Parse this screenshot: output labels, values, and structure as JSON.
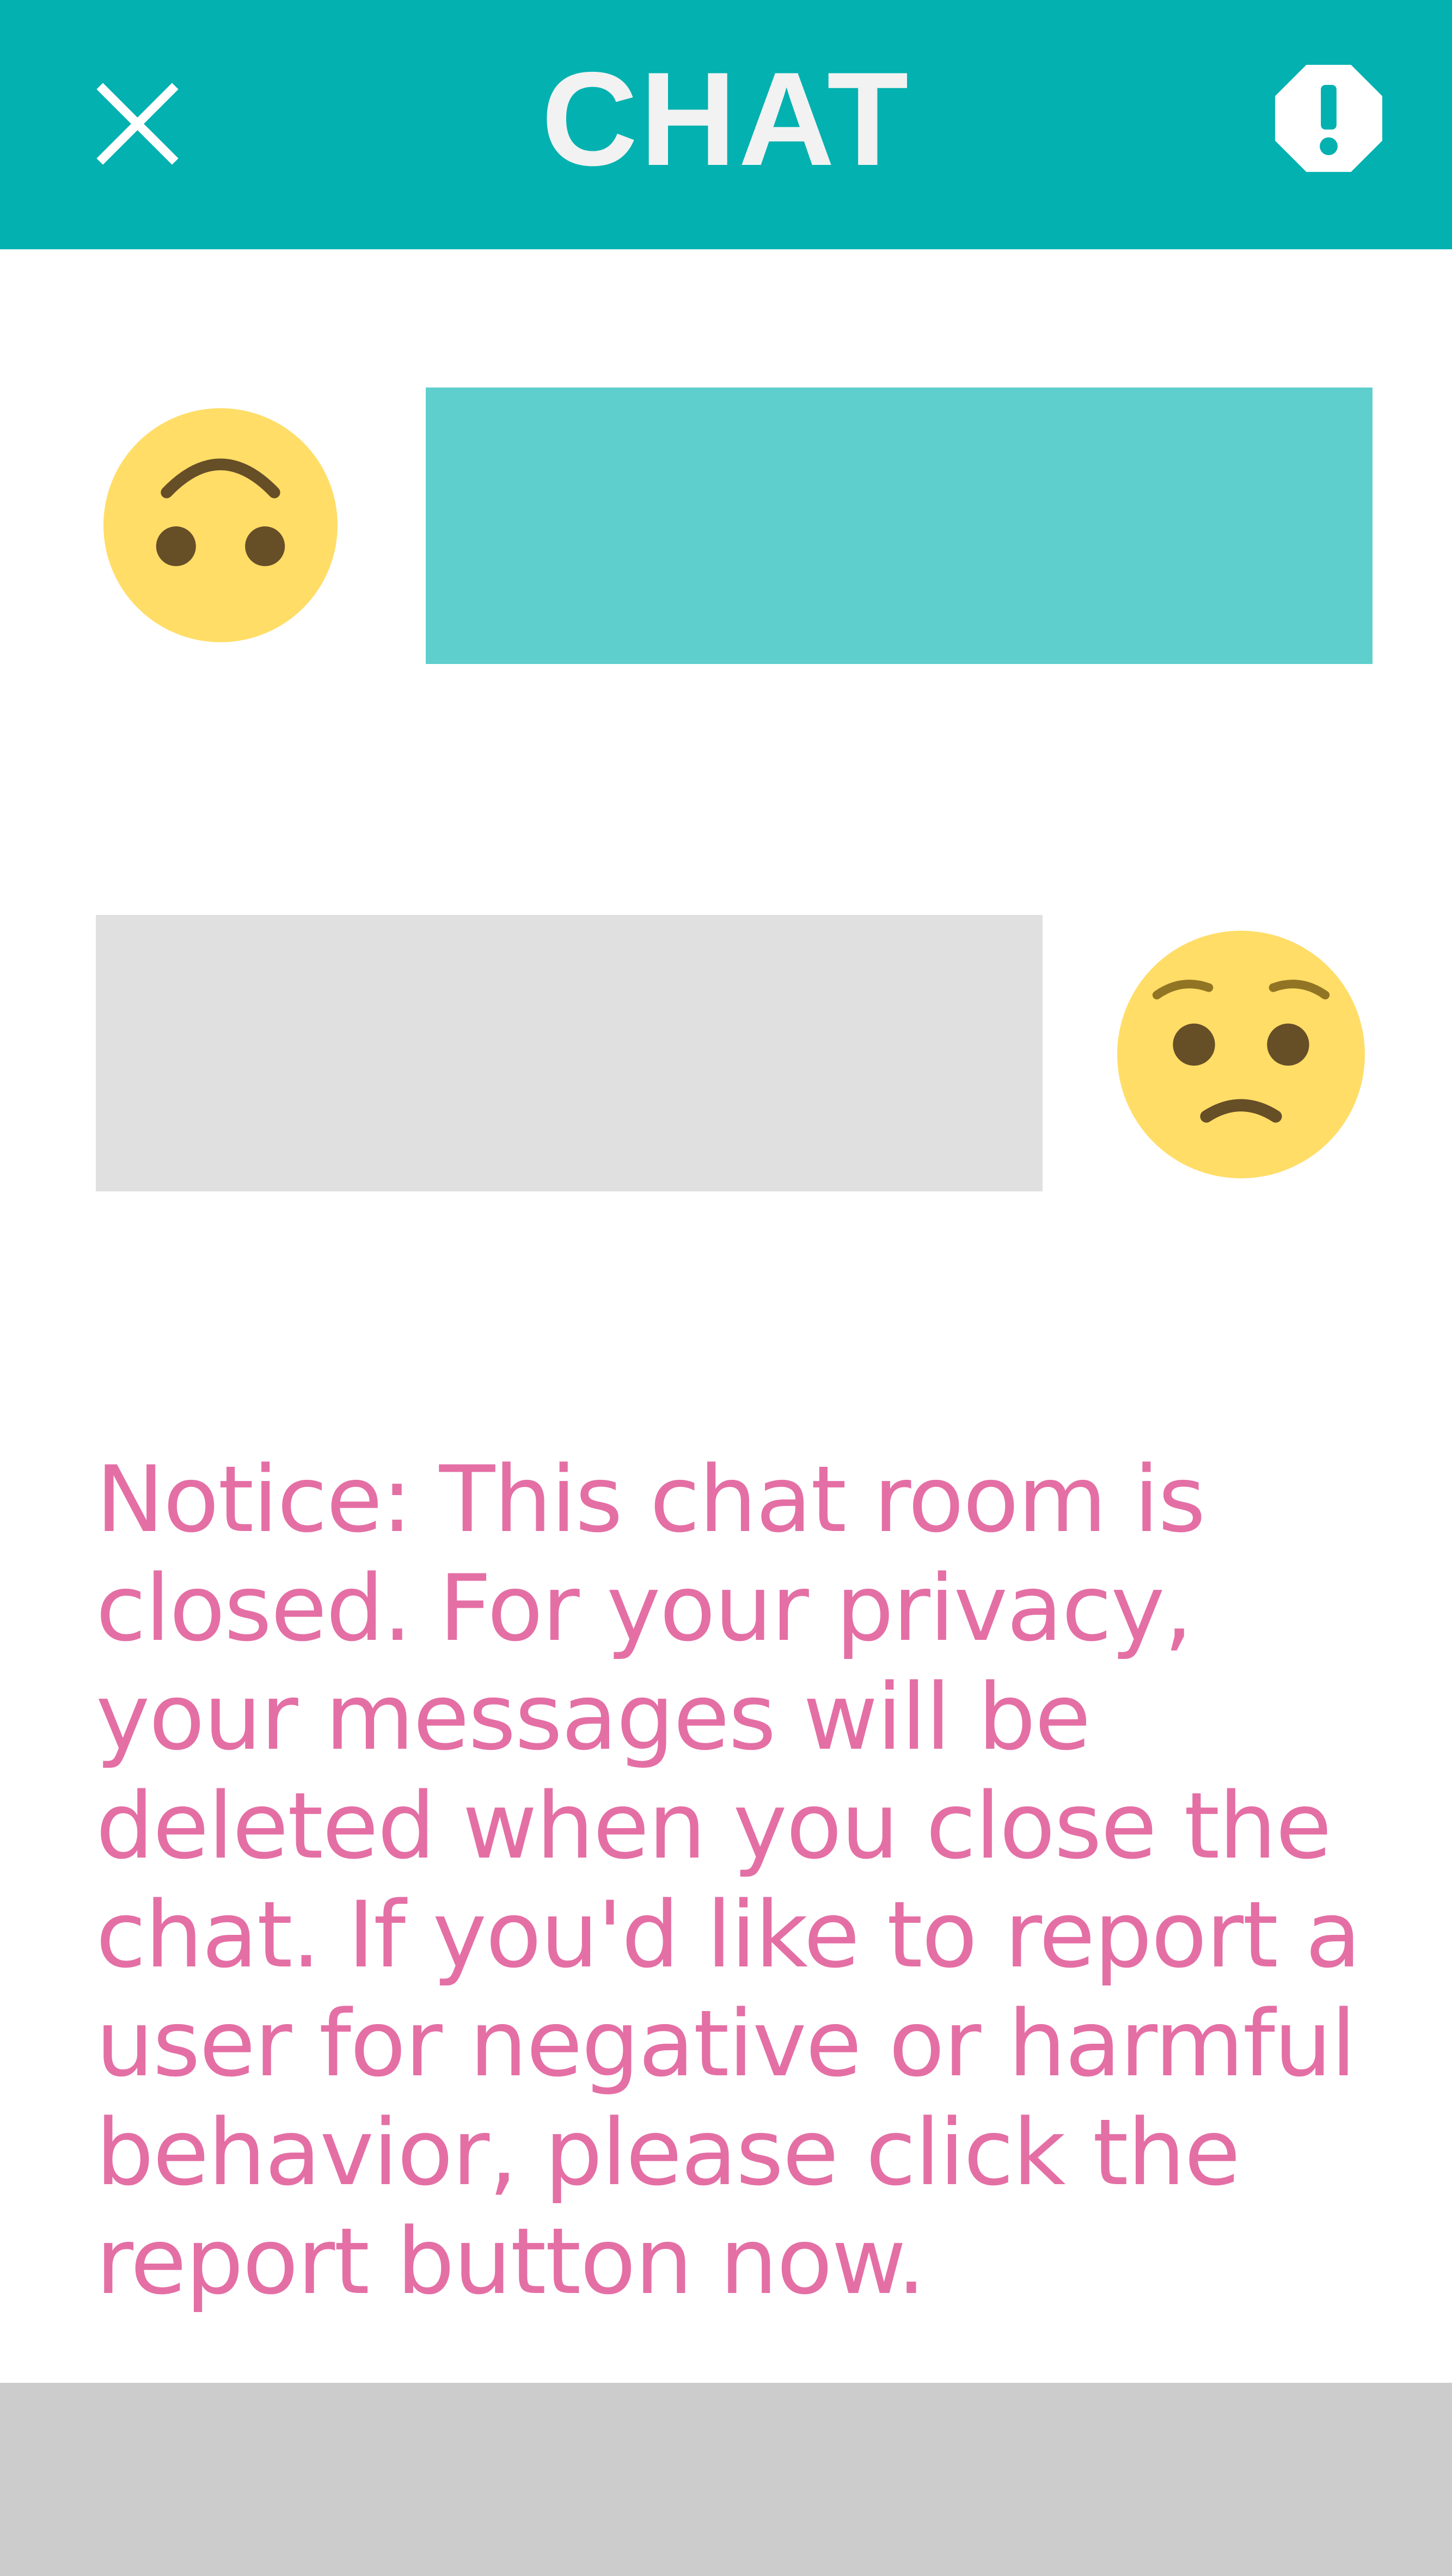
{
  "header": {
    "title": "CHAT",
    "close_icon": "close-icon",
    "report_icon": "report-octagon-icon",
    "background": "#02b1b0"
  },
  "messages": [
    {
      "sender": "other",
      "avatar": "upside-down-face-emoji",
      "bubble_color": "#5ecfcd"
    },
    {
      "sender": "self",
      "avatar": "worried-face-emoji",
      "bubble_color": "#e0e0e0"
    }
  ],
  "notice": {
    "text": "Notice: This chat room is closed. For your privacy, your messages will be deleted when you close the chat. If you'd like to report a user for negative or harmful behavior, please click the report button now.",
    "color": "#e46fa5"
  },
  "colors": {
    "emoji_yellow": "#ffdd67",
    "emoji_features": "#664e27",
    "footer": "#cccccc"
  }
}
